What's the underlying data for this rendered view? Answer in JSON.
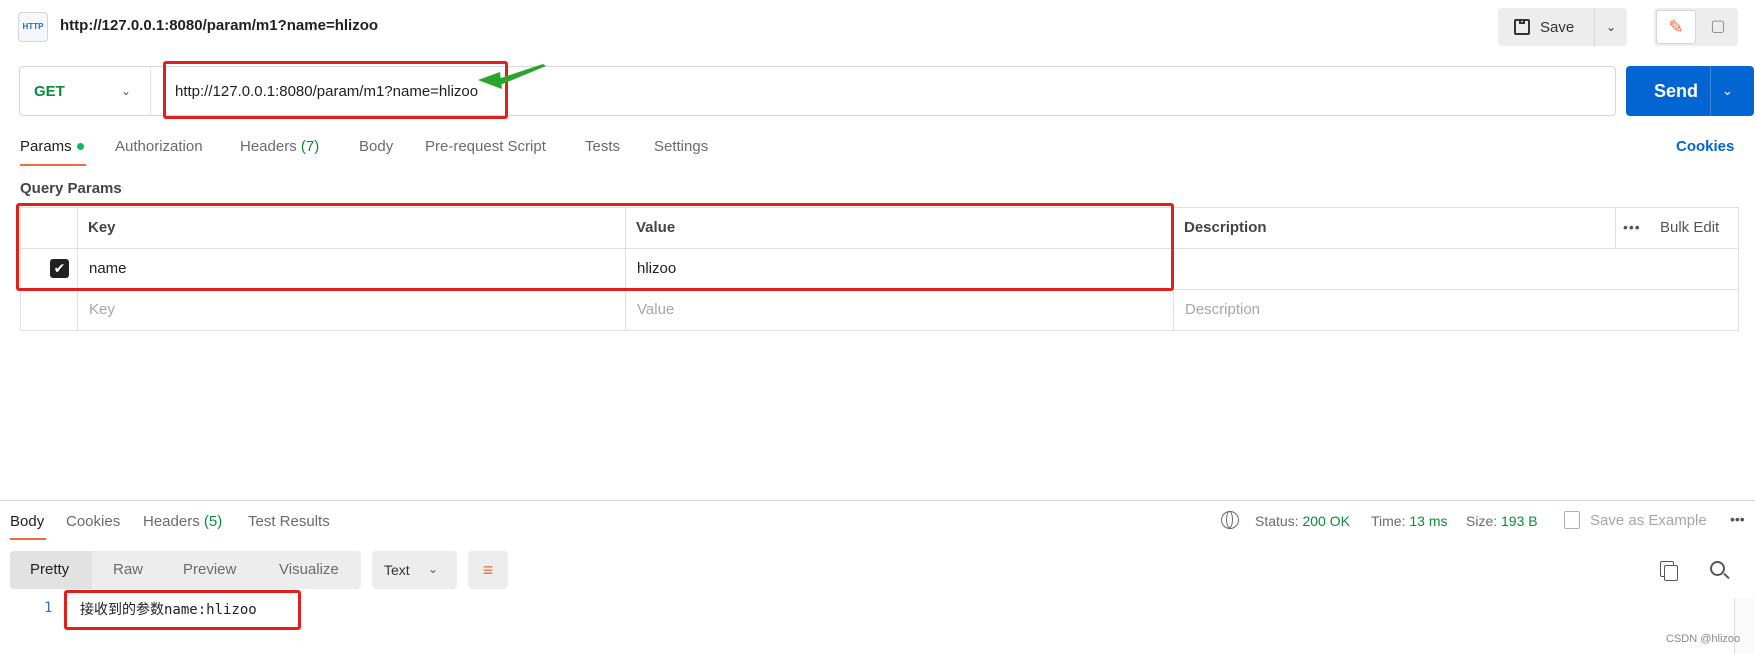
{
  "request": {
    "icon_label": "HTTP",
    "title": "http://127.0.0.1:8080/param/m1?name=hlizoo",
    "save_label": "Save",
    "method": "GET",
    "url": "http://127.0.0.1:8080/param/m1?name=hlizoo",
    "send_label": "Send"
  },
  "tabs": {
    "params": "Params",
    "authorization": "Authorization",
    "headers": "Headers",
    "headers_count": "(7)",
    "body": "Body",
    "prerequest": "Pre-request Script",
    "tests": "Tests",
    "settings": "Settings",
    "cookies": "Cookies"
  },
  "query_params": {
    "title": "Query Params",
    "headers": {
      "key": "Key",
      "value": "Value",
      "description": "Description",
      "bulk_edit": "Bulk Edit"
    },
    "rows": [
      {
        "checked": true,
        "key": "name",
        "value": "hlizoo",
        "description": ""
      }
    ],
    "placeholders": {
      "key": "Key",
      "value": "Value",
      "description": "Description"
    }
  },
  "response": {
    "tabs": {
      "body": "Body",
      "cookies": "Cookies",
      "headers": "Headers",
      "headers_count": "(5)",
      "test_results": "Test Results"
    },
    "status_label": "Status:",
    "status_value": "200 OK",
    "time_label": "Time:",
    "time_value": "13 ms",
    "size_label": "Size:",
    "size_value": "193 B",
    "save_example": "Save as Example",
    "views": {
      "pretty": "Pretty",
      "raw": "Raw",
      "preview": "Preview",
      "visualize": "Visualize"
    },
    "format": "Text",
    "line_number": "1",
    "body_text": "接收到的参数name:hlizoo"
  },
  "watermark": "CSDN @hlizoo",
  "colors": {
    "accent": "#f26b3a",
    "send": "#0265d2",
    "annotation": "#e0201c",
    "arrow": "#2aa52a",
    "method": "#0b8a3e"
  }
}
